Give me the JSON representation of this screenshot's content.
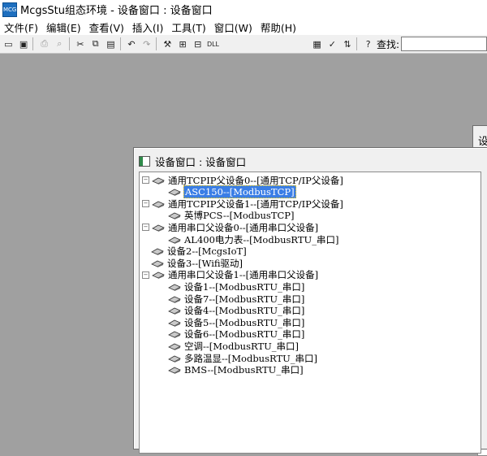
{
  "app": {
    "title": "McgsStu组态环境 - 设备窗口 : 设备窗口",
    "icon_label": "MCGS"
  },
  "menu": [
    {
      "label": "文件(F)"
    },
    {
      "label": "编辑(E)"
    },
    {
      "label": "查看(V)"
    },
    {
      "label": "插入(I)"
    },
    {
      "label": "工具(T)"
    },
    {
      "label": "窗口(W)"
    },
    {
      "label": "帮助(H)"
    }
  ],
  "toolbar": {
    "search_label": "查找:",
    "search_value": ""
  },
  "device_window": {
    "title": "设备窗口 : 设备窗口",
    "tree": [
      {
        "label": "通用TCPIP父设备0--[通用TCP/IP父设备]",
        "level": 0,
        "expander": "−"
      },
      {
        "label": "ASC150--[ModbusTCP]",
        "level": 1,
        "selected": true
      },
      {
        "label": "通用TCPIP父设备1--[通用TCP/IP父设备]",
        "level": 0,
        "expander": "−"
      },
      {
        "label": "英博PCS--[ModbusTCP]",
        "level": 1
      },
      {
        "label": "通用串口父设备0--[通用串口父设备]",
        "level": 0,
        "expander": "−"
      },
      {
        "label": "AL400电力表--[ModbusRTU_串口]",
        "level": 1
      },
      {
        "label": "设备2--[McgsIoT]",
        "level": 0
      },
      {
        "label": "设备3--[Wifi驱动]",
        "level": 0
      },
      {
        "label": "通用串口父设备1--[通用串口父设备]",
        "level": 0,
        "expander": "−"
      },
      {
        "label": "设备1--[ModbusRTU_串口]",
        "level": 1
      },
      {
        "label": "设备7--[ModbusRTU_串口]",
        "level": 1
      },
      {
        "label": "设备4--[ModbusRTU_串口]",
        "level": 1
      },
      {
        "label": "设备5--[ModbusRTU_串口]",
        "level": 1
      },
      {
        "label": "设备6--[ModbusRTU_串口]",
        "level": 1
      },
      {
        "label": "空调--[ModbusRTU_串口]",
        "level": 1
      },
      {
        "label": "多路温显--[ModbusRTU_串口]",
        "level": 1
      },
      {
        "label": "BMS--[ModbusRTU_串口]",
        "level": 1
      }
    ]
  },
  "second_window": {
    "title_fragment": "设"
  }
}
